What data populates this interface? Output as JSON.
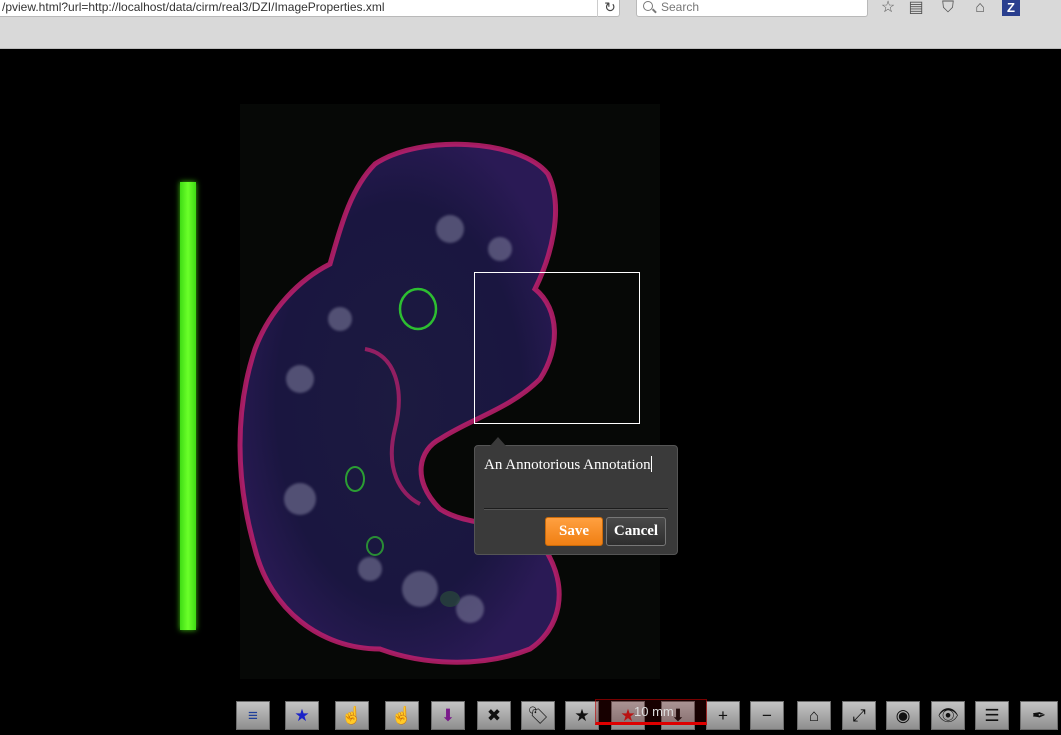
{
  "browser": {
    "url": "/pview.html?url=http://localhost/data/cirm/real3/DZI/ImageProperties.xml",
    "search_placeholder": "Search",
    "toolbar_icons": [
      "star-icon",
      "reader-icon",
      "pocket-icon",
      "home-icon",
      "zotero-icon"
    ],
    "zotero_label": "Z"
  },
  "annotation": {
    "text": "An Annotorious Annotation",
    "save_label": "Save",
    "cancel_label": "Cancel"
  },
  "scale": {
    "label": "10 mm"
  },
  "viewer_toolbar": [
    {
      "name": "layers-button",
      "icon": "layers-icon",
      "glyph": "≡",
      "color": "#1f3f9a"
    },
    {
      "name": "star-blue-button",
      "icon": "star-icon",
      "glyph": "★",
      "color": "#1a22c8"
    },
    {
      "name": "hand-red-button",
      "icon": "hand-pointer-icon",
      "glyph": "☝",
      "color": "#c00"
    },
    {
      "name": "hand-green-button",
      "icon": "hand-pointer-icon",
      "glyph": "☝",
      "color": "#2a8a2a"
    },
    {
      "name": "download-purple-button",
      "icon": "download-circle-icon",
      "glyph": "⬇",
      "color": "#7a1a8a"
    },
    {
      "name": "close-button",
      "icon": "close-icon",
      "glyph": "✖",
      "color": "#111"
    },
    {
      "name": "tag-button",
      "icon": "tag-icon",
      "glyph": "🏷",
      "color": "#111"
    },
    {
      "name": "star-black-button",
      "icon": "star-icon",
      "glyph": "★",
      "color": "#111"
    },
    {
      "name": "star-red-button",
      "icon": "star-icon",
      "glyph": "★",
      "color": "#d81a1a"
    },
    {
      "name": "download-button",
      "icon": "download-circle-icon",
      "glyph": "⬇",
      "color": "#111"
    },
    {
      "name": "zoom-in-button",
      "icon": "plus-icon",
      "glyph": "+",
      "color": "#111"
    },
    {
      "name": "zoom-out-button",
      "icon": "minus-icon",
      "glyph": "−",
      "color": "#111"
    },
    {
      "name": "home-button",
      "icon": "home-icon",
      "glyph": "⌂",
      "color": "#111"
    },
    {
      "name": "fullscreen-button",
      "icon": "fullscreen-icon",
      "glyph": "⤢",
      "color": "#111"
    },
    {
      "name": "target-button",
      "icon": "target-icon",
      "glyph": "◉",
      "color": "#111"
    },
    {
      "name": "eye-button",
      "icon": "eye-icon",
      "glyph": "👁",
      "color": "#111"
    },
    {
      "name": "menu-button",
      "icon": "menu-icon",
      "glyph": "☰",
      "color": "#111"
    },
    {
      "name": "annotate-button",
      "icon": "feather-icon",
      "glyph": "✒",
      "color": "#111"
    }
  ]
}
